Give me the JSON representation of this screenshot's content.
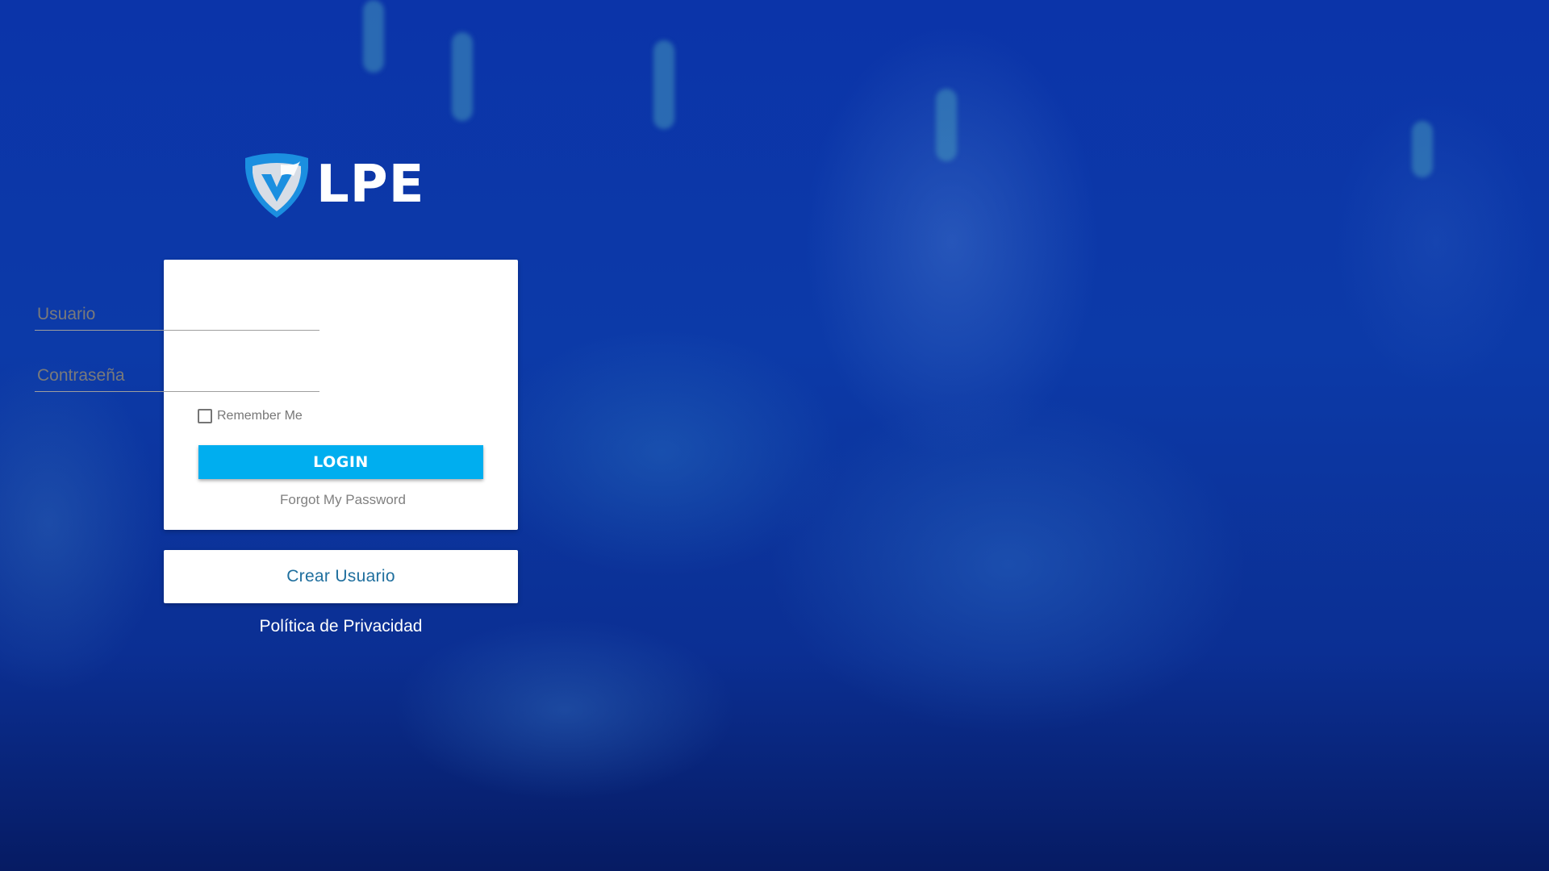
{
  "brand": {
    "logo_text": "LPE",
    "colors": {
      "shield_blue": "#1b8fe0",
      "shield_grey": "#d7dde6"
    }
  },
  "login_form": {
    "username_placeholder": "Usuario",
    "password_placeholder": "Contraseña",
    "remember_label": "Remember Me",
    "remember_checked": false,
    "login_button_label": "LOGIN",
    "forgot_label": "Forgot My Password"
  },
  "create_user_label": "Crear Usuario",
  "privacy_label": "Política de Privacidad",
  "colors": {
    "accent": "#00aeef",
    "background": "#0b34a9",
    "create_link": "#1f6f9e"
  }
}
